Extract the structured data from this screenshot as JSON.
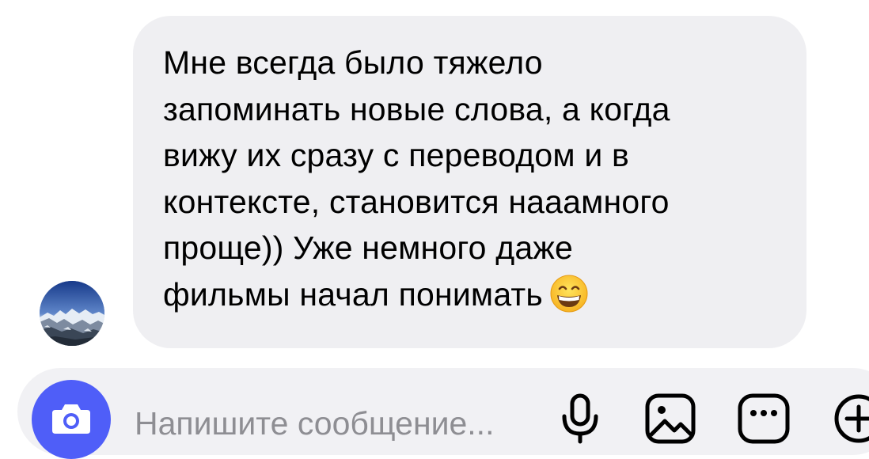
{
  "conversation": {
    "incoming_message": {
      "lines": [
        "Мне всегда было тяжело",
        "запоминать новые слова, а когда",
        "вижу их сразу с переводом и в",
        "контексте, становится нааамного",
        "проще)) Уже немного даже",
        "фильмы начал понимать"
      ],
      "emoji": "grinning-face-with-smiling-eyes"
    },
    "sender_avatar": "mountain-landscape-avatar"
  },
  "composer": {
    "placeholder": "Напишите сообщение...",
    "value": "",
    "camera_icon": "camera-icon",
    "tools": [
      "microphone-icon",
      "gallery-icon",
      "more-icon",
      "add-icon"
    ],
    "accent_color": "#4f5ef8"
  },
  "colors": {
    "bubble_background": "#efeff2",
    "composer_background": "#f1f1f4",
    "text": "#000000",
    "placeholder": "#8e8e93"
  }
}
